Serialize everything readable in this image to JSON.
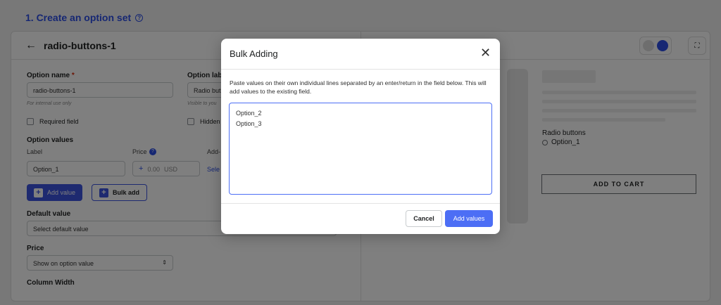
{
  "page": {
    "step_title": "1. Create an option set",
    "help_icon": "question-circle-icon"
  },
  "editor": {
    "title": "radio-buttons-1",
    "option_name_label": "Option name",
    "option_name_required": "*",
    "option_name_value": "radio-buttons-1",
    "option_name_hint": "For internal use only",
    "option_label_label": "Option lab",
    "option_label_value": "Radio but",
    "option_label_hint": "Visible to you",
    "required_field_label": "Required field",
    "hidden_label": "Hidden",
    "option_values_heading": "Option values",
    "col_label": "Label",
    "col_price": "Price",
    "col_addon": "Add-",
    "value_1_label": "Option_1",
    "price_prefix": "+",
    "price_value": "0.00",
    "price_currency": "USD",
    "select_link": "Sele",
    "add_value_button": "Add value",
    "bulk_add_button": "Bulk add",
    "default_value_heading": "Default value",
    "default_value_placeholder": "Select default value",
    "price_heading": "Price",
    "price_select_value": "Show on option value",
    "column_width_heading": "Column Width"
  },
  "preview": {
    "radio_title": "Radio buttons",
    "radio_option": "Option_1",
    "add_to_cart": "ADD TO CART"
  },
  "modal": {
    "title": "Bulk Adding",
    "description": "Paste values on their own individual lines separated by an enter/return in the field below. This will add values to the existing field.",
    "textarea_value": "Option_2\nOption_3",
    "cancel_button": "Cancel",
    "add_button": "Add values"
  },
  "colors": {
    "accent": "#3c55e0",
    "modal_primary": "#4c6ef5",
    "step_title": "#2c4ee6"
  }
}
